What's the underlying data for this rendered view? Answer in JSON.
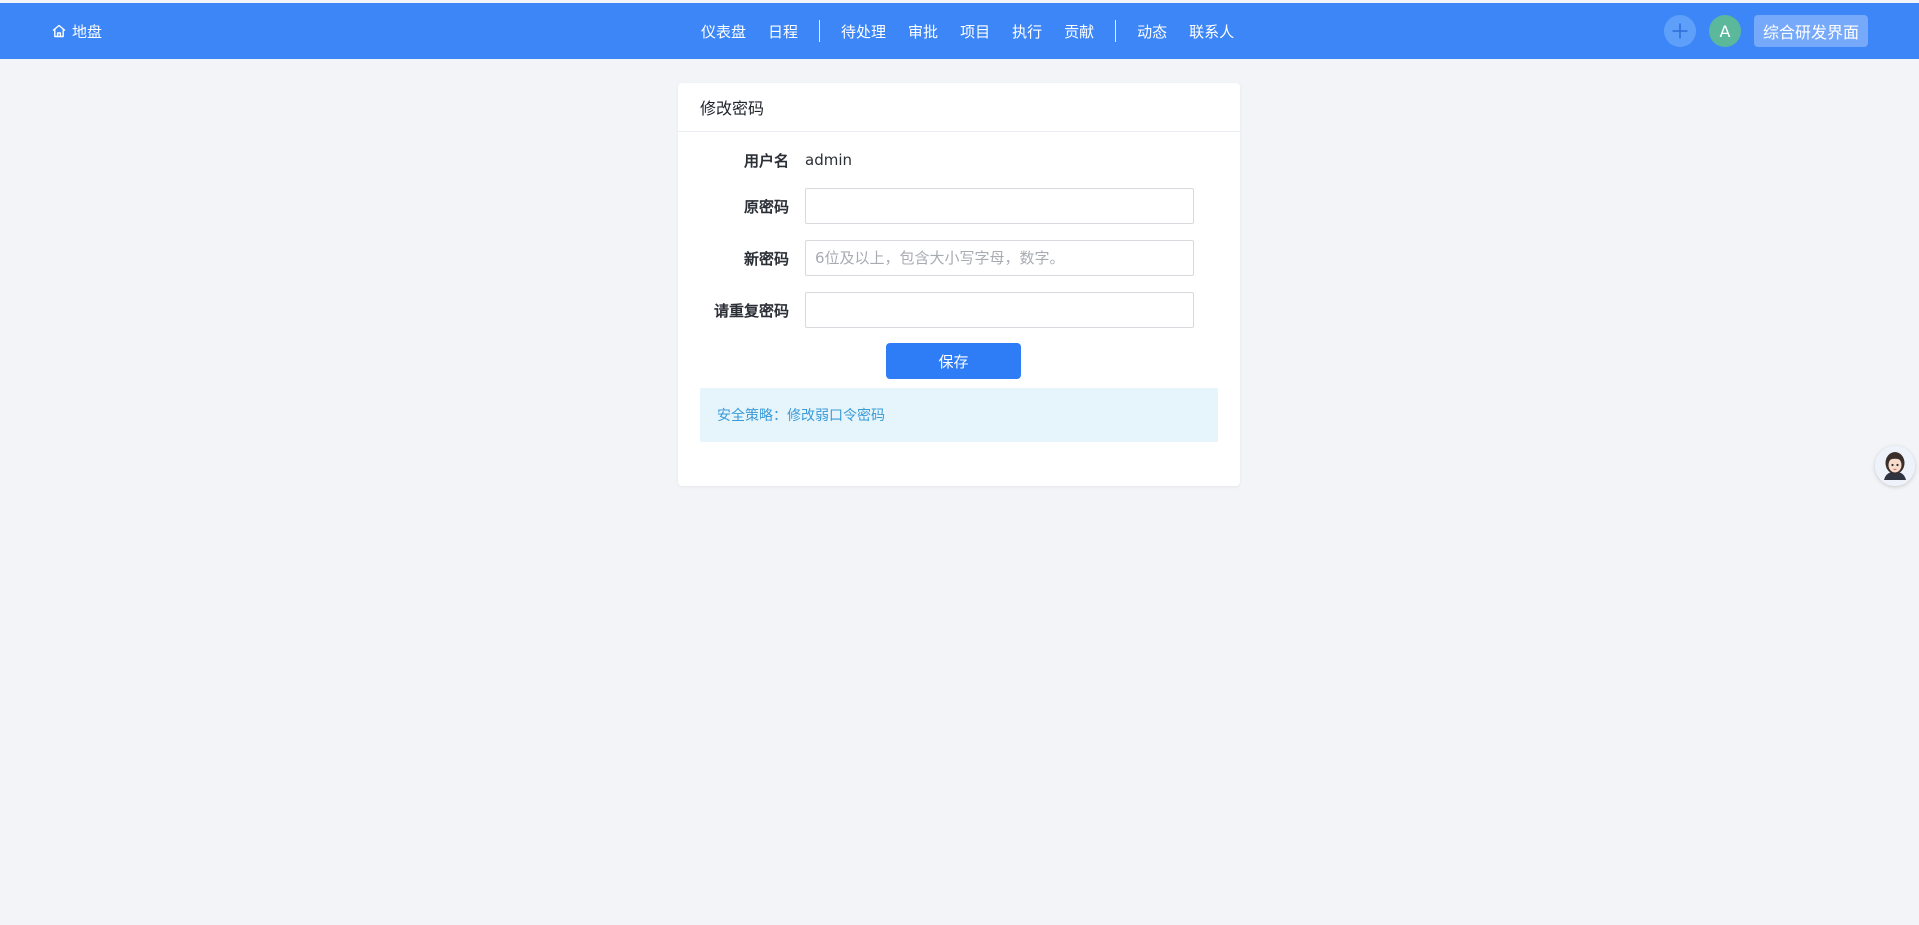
{
  "header": {
    "home_label": "地盘",
    "nav_group1": [
      "仪表盘",
      "日程"
    ],
    "nav_group2": [
      "待处理",
      "审批",
      "项目",
      "执行",
      "贡献"
    ],
    "nav_group3": [
      "动态",
      "联系人"
    ],
    "avatar_letter": "A",
    "workspace_label": "综合研发界面"
  },
  "card": {
    "title": "修改密码",
    "username_label": "用户名",
    "username_value": "admin",
    "old_password_label": "原密码",
    "old_password_value": "",
    "new_password_label": "新密码",
    "new_password_value": "",
    "new_password_placeholder": "6位及以上，包含大小写字母，数字。",
    "repeat_password_label": "请重复密码",
    "repeat_password_value": "",
    "save_label": "保存",
    "notice_text": "安全策略：修改弱口令密码"
  },
  "colors": {
    "header_bg": "#3d86f7",
    "primary_button": "#2e7cf6",
    "avatar_bg": "#5bb89b",
    "notice_bg": "#e6f4fc",
    "notice_text": "#3a9bd8",
    "page_bg": "#f2f4f7"
  },
  "icons": {
    "home": "home-icon",
    "plus": "plus-icon",
    "helper": "assistant-avatar-icon"
  }
}
